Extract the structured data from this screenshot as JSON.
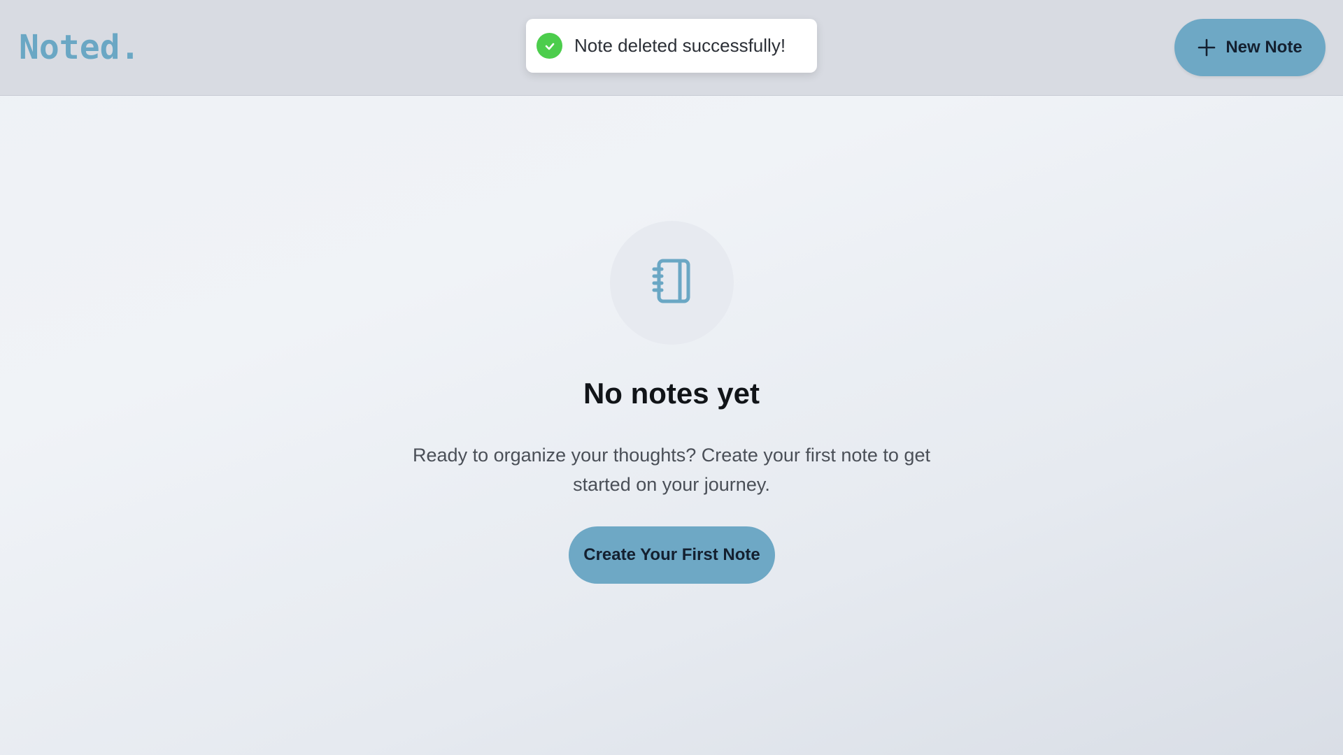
{
  "app": {
    "logo": "Noted."
  },
  "header": {
    "new_note_label": "New Note",
    "new_note_icon": "plus-icon"
  },
  "toast": {
    "message": "Note deleted successfully!",
    "icon": "check-circle-icon",
    "status_color": "#4ccd4c"
  },
  "empty_state": {
    "icon": "notebook-icon",
    "title": "No notes yet",
    "description": "Ready to organize your thoughts? Create your first note to get started on your journey.",
    "cta_label": "Create Your First Note"
  },
  "colors": {
    "accent": "#6ea8c5",
    "logo": "#6aa7c4",
    "header_bg": "#d8dbe2"
  }
}
